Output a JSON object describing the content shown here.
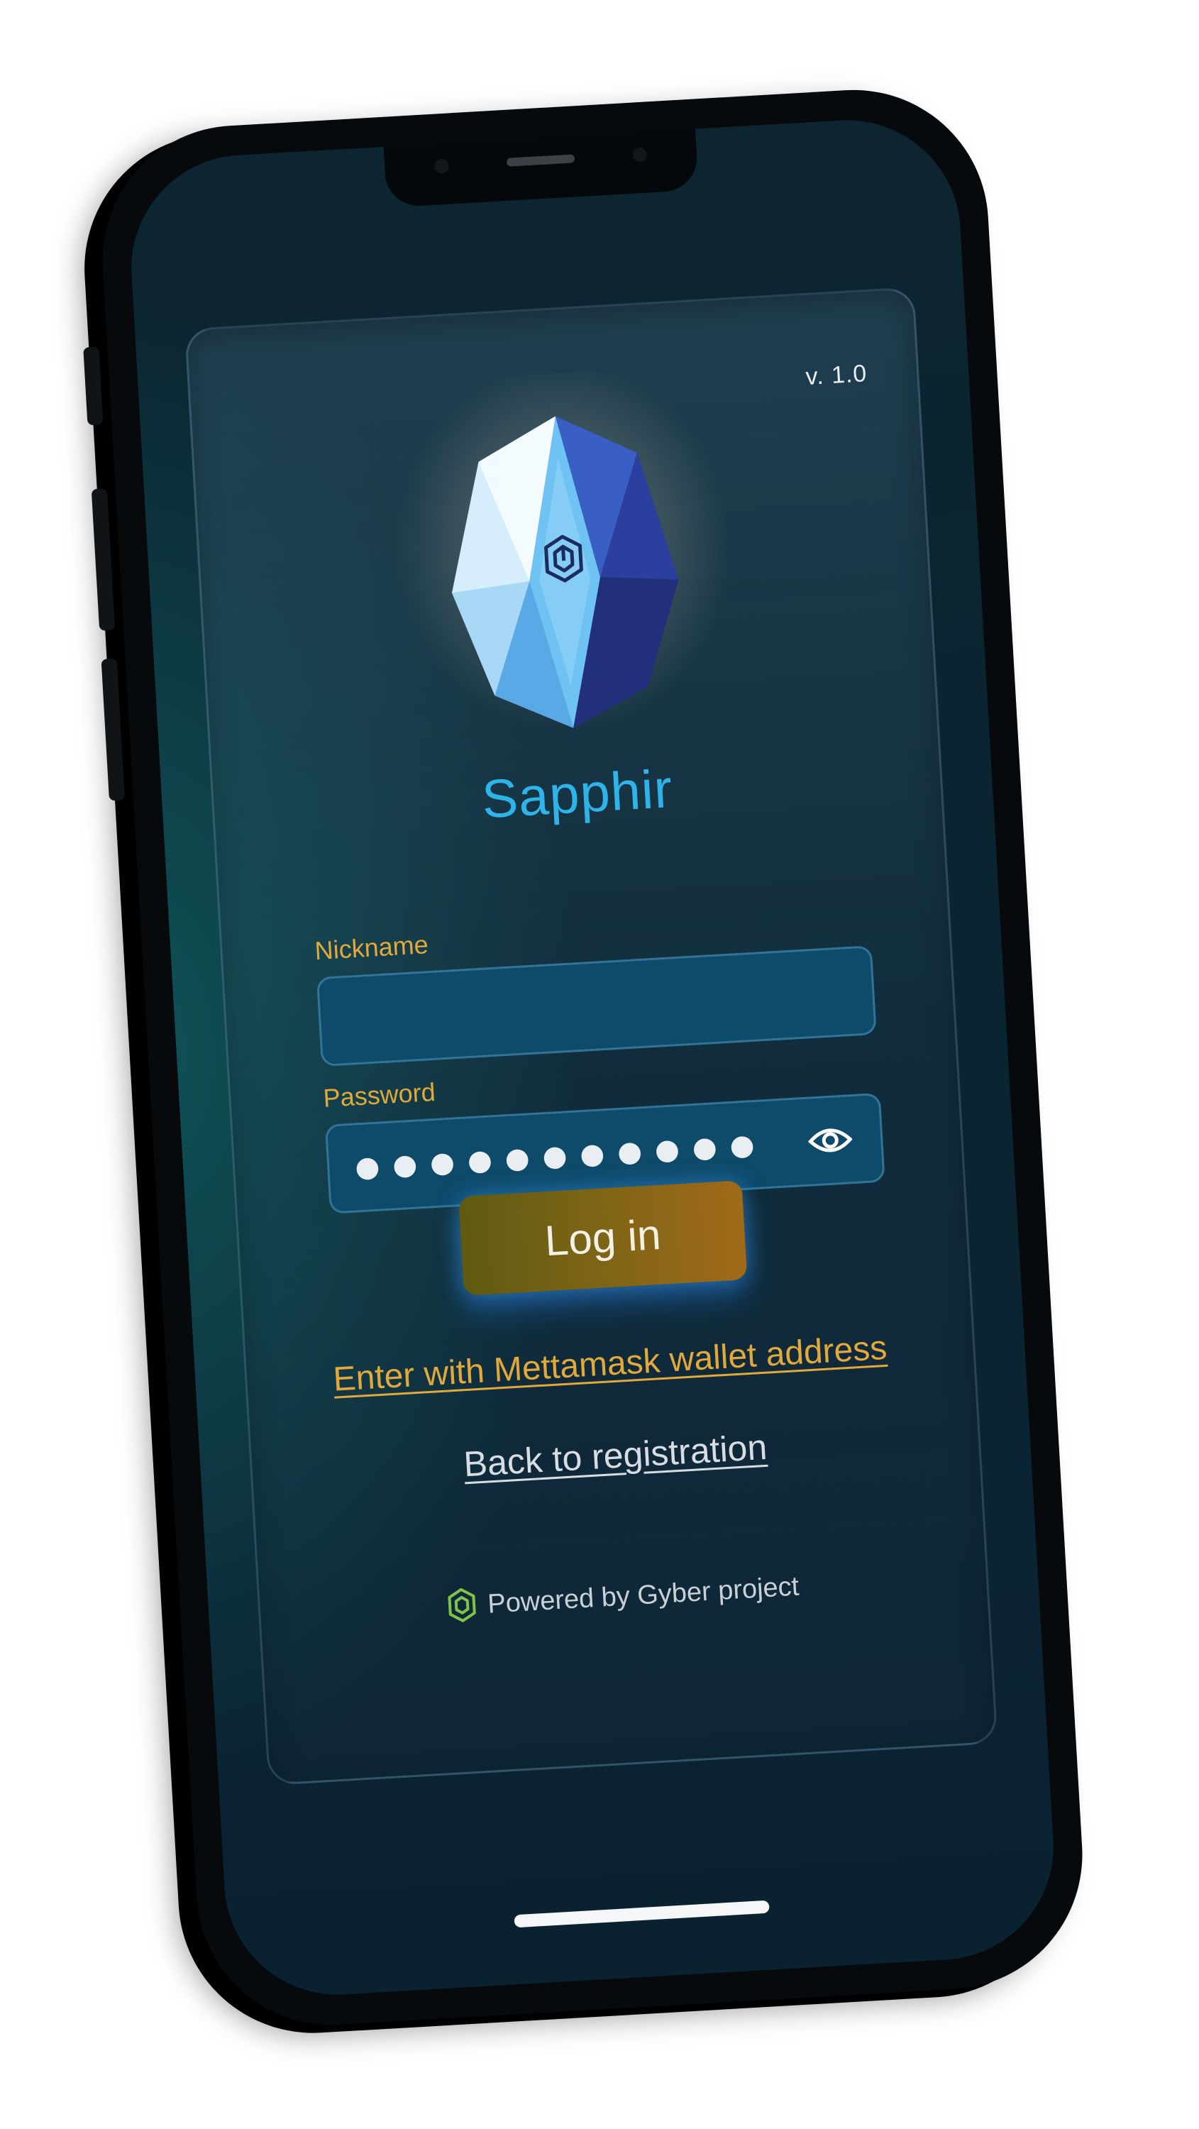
{
  "app": {
    "version": "v. 1.0",
    "name": "Sapphir"
  },
  "login_form": {
    "nickname_label": "Nickname",
    "nickname_value": "",
    "password_label": "Password",
    "password_masked": "●●●●●●●●●●●",
    "login_button": "Log in"
  },
  "links": {
    "metamask": "Enter with Mettamask wallet address",
    "back": "Back to registration"
  },
  "footer": {
    "powered_by": "Powered by Gyber project"
  },
  "icons": {
    "gem": "sapphire-gem-icon",
    "eye": "eye-icon",
    "brand": "gyber-logo-icon"
  },
  "colors": {
    "accent_blue": "#2fb4ea",
    "accent_gold": "#e1a93a",
    "field_bg": "#0e4a6a"
  }
}
